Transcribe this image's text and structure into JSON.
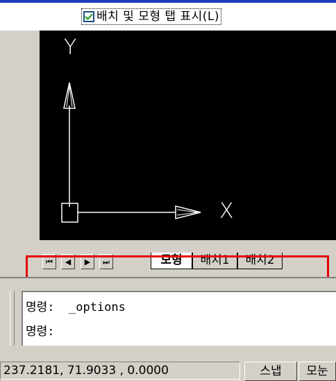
{
  "checkbox": {
    "label": "배치 및 모형 탭 표시(L)",
    "checked": true
  },
  "ucs": {
    "y_label": "Y",
    "x_label": "X"
  },
  "tab_nav": {
    "first": "⏮",
    "prev": "◀",
    "next": "▶",
    "last": "⏭"
  },
  "tabs": [
    {
      "label": "모형",
      "active": true
    },
    {
      "label": "배치1",
      "active": false
    },
    {
      "label": "배치2",
      "active": false
    }
  ],
  "command": {
    "line1": "명령:  _options",
    "line2": "명령:"
  },
  "status": {
    "coords": "237.2181, 71.9033 , 0.0000",
    "snap_label": "스냅",
    "grid_label": "모눈"
  },
  "colors": {
    "highlight": "#e40000",
    "canvas": "#000000",
    "ucs_line": "#ffffff"
  }
}
